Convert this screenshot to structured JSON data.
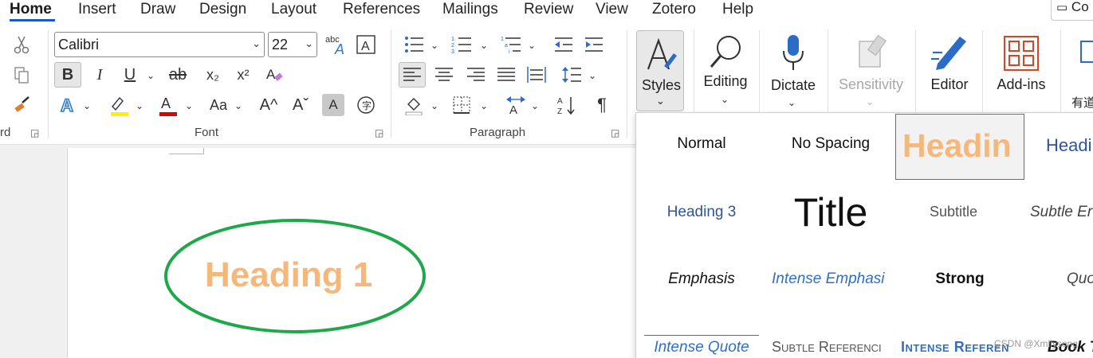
{
  "tabs": [
    "Home",
    "Insert",
    "Draw",
    "Design",
    "Layout",
    "References",
    "Mailings",
    "Review",
    "View",
    "Zotero",
    "Help"
  ],
  "comments_label": "Co",
  "clipboard": {
    "label": "rd"
  },
  "font": {
    "family": "Calibri",
    "size": "22",
    "label": "Font",
    "bold": "B",
    "italic": "I",
    "underline": "U",
    "strikethrough": "ab",
    "subscript": "x₂",
    "superscript": "x²",
    "change_case": "Aa",
    "grow": "A^",
    "shrink": "Aˇ",
    "clear_a": "A",
    "highlight_color": "#ffef00",
    "font_color": "#e00000",
    "accent": "#185abd"
  },
  "paragraph": {
    "label": "Paragraph",
    "pilcrow": "¶"
  },
  "styles_button": {
    "label": "Styles"
  },
  "editing": {
    "label": "Editing"
  },
  "dictate": {
    "label": "Dictate"
  },
  "sensitivity": {
    "label": "Sensitivity"
  },
  "editor": {
    "label": "Editor"
  },
  "addins": {
    "label": "Add-ins"
  },
  "cut_off": {
    "label": "有道"
  },
  "document": {
    "heading": "Heading 1",
    "heading_color": "#f6b87a",
    "annotation_color": "#1ea84a"
  },
  "gallery": {
    "row1": [
      "Normal",
      "No Spacing",
      "Headin",
      "Headi"
    ],
    "row2": [
      "Heading 3",
      "Title",
      "Subtitle",
      "Subtle Er"
    ],
    "row3": [
      "Emphasis",
      "Intense Emphasi",
      "Strong",
      "Quo"
    ],
    "row4": [
      "Intense Quote",
      "Subtle Referenci",
      "Intense Referen",
      "Book T"
    ]
  },
  "watermark": "CSDN @Xmllysong"
}
